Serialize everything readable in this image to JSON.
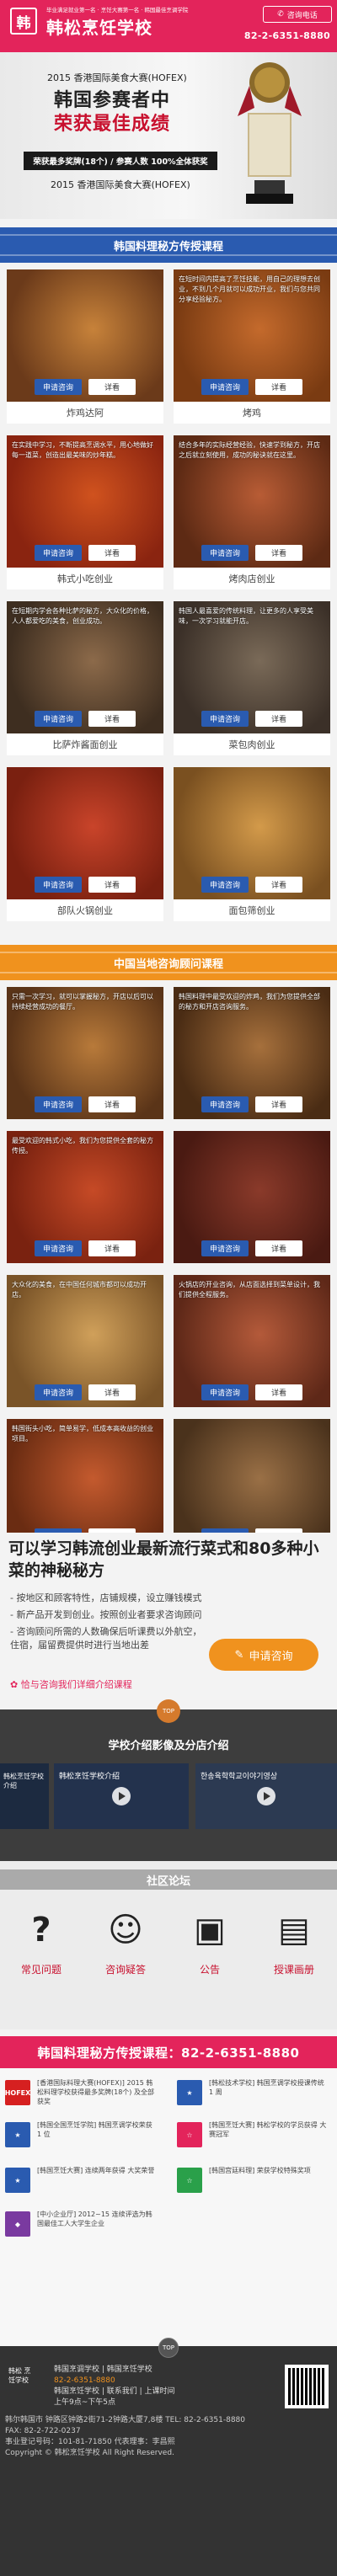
{
  "header": {
    "logo_glyph": "韩",
    "slogan": "毕业满足就业第一名 · 烹饪大赛第一名 · 韩国最佳烹调学院",
    "brand": "韩松烹饪学校",
    "consult_label": "咨询电话",
    "phone": "82-2-6351-8880"
  },
  "banner": {
    "year_line": "2015 香港国际美食大赛(HOFEX)",
    "title_line1": "韩国参赛者中",
    "title_line2": "荣获最佳成绩",
    "ribbon": "荣获最多奖牌(18个) / 参赛人数 100%全体获奖",
    "event_line": "2015 香港国际美食大赛(HOFEX)",
    "slide_count": 6,
    "active_slide": 1
  },
  "section1": {
    "title": "韩国料理秘方传授课程",
    "apply_label": "申请咨询",
    "detail_label": "详看",
    "items": [
      {
        "name": "炸鸡达阿",
        "color1": "#c7823a",
        "color2": "#6b3a1a",
        "text": ""
      },
      {
        "name": "烤鸡",
        "color1": "#c46a2c",
        "color2": "#7a3b12",
        "text": "在短时间内提高了烹饪技能，用自己的理想去创业，不到几个月就可以成功开业，我们与您共同分享经验秘方。"
      },
      {
        "name": "韩式小吃创业",
        "color1": "#d0521e",
        "color2": "#8a2410",
        "text": "在实践中学习，不断提高烹调水平，用心地做好每一道菜，创造出最美味的炒年糕。"
      },
      {
        "name": "烤肉店创业",
        "color1": "#b85c35",
        "color2": "#5d2a14",
        "text": "结合多年的实际经营经验，快速学到秘方，开店之后就立刻使用，成功的秘诀就在这里。"
      },
      {
        "name": "比萨炸酱面创业",
        "color1": "#8c6a4a",
        "color2": "#3e2e20",
        "text": "在短期内学会各种比萨的秘方，大众化的价格，人人都爱吃的美食，创业成功。"
      },
      {
        "name": "菜包肉创业",
        "color1": "#7a6a58",
        "color2": "#3b3028",
        "text": "韩国人最喜爱的传统料理，让更多的人享受美味，一次学习就能开店。"
      },
      {
        "name": "部队火锅创业",
        "color1": "#c9442a",
        "color2": "#7a2010",
        "text": ""
      },
      {
        "name": "面包筛创业",
        "color1": "#d39a4a",
        "color2": "#7a5020",
        "text": ""
      }
    ]
  },
  "section2": {
    "title": "中国当地咨询顾问课程",
    "apply_label": "申请咨询",
    "detail_label": "详看",
    "items": [
      {
        "name": "",
        "color1": "#b87a3a",
        "color2": "#5a3418",
        "text": "只需一次学习，就可以掌握秘方，开店以后可以持续经营成功的餐厅。"
      },
      {
        "name": "",
        "color1": "#a6703c",
        "color2": "#4a2c14",
        "text": "韩国料理中最受欢迎的炸鸡，我们为您提供全部的秘方和开店咨询服务。"
      },
      {
        "name": "",
        "color1": "#c64a26",
        "color2": "#7a2210",
        "text": "最受欢迎的韩式小吃，我们为您提供全套的秘方传授。"
      },
      {
        "name": "",
        "color1": "#8a3a2a",
        "color2": "#4a1a12",
        "text": ""
      },
      {
        "name": "",
        "color1": "#d0a05a",
        "color2": "#7a5428",
        "text": "大众化的美食，在中国任何城市都可以成功开店。"
      },
      {
        "name": "",
        "color1": "#b45a3a",
        "color2": "#5e2818",
        "text": "火锅店的开业咨询，从店面选择到菜单设计，我们提供全程服务。"
      },
      {
        "name": "",
        "color1": "#c45a2e",
        "color2": "#6a2c12",
        "text": "韩国街头小吃，简单易学，低成本高收益的创业项目。"
      },
      {
        "name": "",
        "color1": "#9a7046",
        "color2": "#4a321c",
        "text": ""
      }
    ]
  },
  "startup": {
    "title": "可以学习韩流创业最新流行菜式和80多种小菜的神秘秘方",
    "bullets": [
      "- 按地区和顾客特性，店铺规模，设立赚钱模式",
      "- 新产品开发到创业。按照创业者要求咨询顾问",
      "- 咨询顾问所需的人数确保后听课费以外航空，住宿，届留费提供时进行当地出差"
    ],
    "link": "✿ 恰与咨询我们详细介绍课程",
    "button_label": "申请咨询"
  },
  "video": {
    "top_label": "TOP",
    "title": "学校介绍影像及分店介绍",
    "items": [
      {
        "caption": "韩松烹饪学校介绍"
      },
      {
        "caption": "韩松烹饪学校介绍"
      },
      {
        "caption": "한송육학학교이야기영상"
      }
    ]
  },
  "community": {
    "title": "社区论坛",
    "items": [
      {
        "label": "常见问题",
        "glyph": "?"
      },
      {
        "label": "咨询疑答",
        "glyph": "☺"
      },
      {
        "label": "公告",
        "glyph": "▣"
      },
      {
        "label": "授课画册",
        "glyph": "▤"
      }
    ]
  },
  "hotline": {
    "text": "韩国料理秘方传授课程：82-2-6351-8880"
  },
  "news": {
    "items": [
      {
        "logo": "HOFEX",
        "logo_color": "#d62020",
        "text": "[香港国际料理大赛(HOFEX)] 2015 韩松料理学校获得最多奖牌(18个) 及全部获奖"
      },
      {
        "logo": "★",
        "logo_color": "#2a5bb0",
        "text": "[韩松技术学校] 韩国烹调学校授课传统 1 周"
      },
      {
        "logo": "★",
        "logo_color": "#2a5bb0",
        "text": "[韩国全国烹饪学院] 韩国烹调学校荣获 1 位"
      },
      {
        "logo": "☆",
        "logo_color": "#e3245b",
        "text": "[韩国烹饪大赛] 韩松学校的学员获得 大赛冠军"
      },
      {
        "logo": "★",
        "logo_color": "#2a5bb0",
        "text": "[韩国烹饪大赛] 连续两年获得 大奖荣誉"
      },
      {
        "logo": "☆",
        "logo_color": "#2aa04a",
        "text": "[韩国宫廷料理] 荣获学校特殊奖项"
      },
      {
        "logo": "◆",
        "logo_color": "#7a3aa0",
        "text": "[中小企业厅] 2012~15 连续评选为韩国最佳工人大学生企业"
      }
    ]
  },
  "footer": {
    "top_label": "TOP",
    "logo_text": "韩松 烹饪学校",
    "lines": [
      "韩国烹调学校 | 韩国烹饪学校",
      "82-2-6351-8880",
      "韩国烹饪学校 | 联系我们 | 上课时间",
      "上午9点~下午5点"
    ],
    "address": [
      "韩尔韩国市 钟路区钟路2街71-2钟路大厦7,8楼 TEL: 82-2-6351-8880",
      "FAX: 82-2-722-0237",
      "事业登记号码：101-81-71850 代表理事：李昌熙",
      "Copyright © 韩松烹饪学校 All Right Reserved."
    ]
  }
}
